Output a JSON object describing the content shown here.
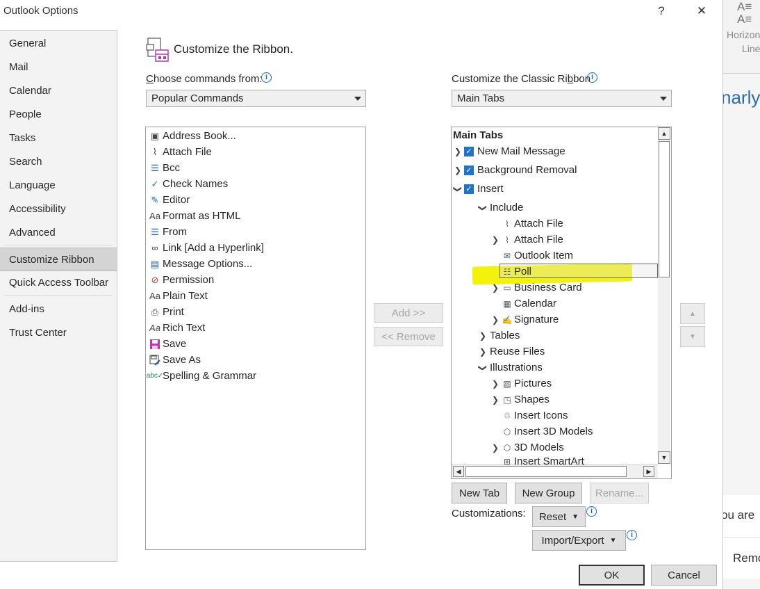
{
  "window": {
    "title": "Outlook Options",
    "help": "?",
    "close": "✕"
  },
  "nav": {
    "items": [
      {
        "label": "General"
      },
      {
        "label": "Mail"
      },
      {
        "label": "Calendar"
      },
      {
        "label": "People"
      },
      {
        "label": "Tasks"
      },
      {
        "label": "Search"
      },
      {
        "label": "Language"
      },
      {
        "label": "Accessibility"
      },
      {
        "label": "Advanced"
      },
      {
        "label": "Customize Ribbon"
      },
      {
        "label": "Quick Access Toolbar"
      },
      {
        "label": "Add-ins"
      },
      {
        "label": "Trust Center"
      }
    ],
    "active": "Customize Ribbon"
  },
  "header": {
    "title": "Customize the Ribbon."
  },
  "left": {
    "label": "Choose commands from:",
    "select_value": "Popular Commands",
    "commands": [
      {
        "label": "Address Book...",
        "icon": "address-book-icon"
      },
      {
        "label": "Attach File",
        "icon": "paperclip-icon"
      },
      {
        "label": "Bcc",
        "icon": "bcc-icon"
      },
      {
        "label": "Check Names",
        "icon": "check-names-icon"
      },
      {
        "label": "Editor",
        "icon": "editor-pen-icon"
      },
      {
        "label": "Format as HTML",
        "icon": "format-html-icon"
      },
      {
        "label": "From",
        "icon": "from-icon"
      },
      {
        "label": "Link [Add a Hyperlink]",
        "icon": "link-icon"
      },
      {
        "label": "Message Options...",
        "icon": "message-options-icon"
      },
      {
        "label": "Permission",
        "icon": "permission-icon"
      },
      {
        "label": "Plain Text",
        "icon": "plain-text-icon"
      },
      {
        "label": "Print",
        "icon": "printer-icon"
      },
      {
        "label": "Rich Text",
        "icon": "rich-text-icon"
      },
      {
        "label": "Save",
        "icon": "save-icon"
      },
      {
        "label": "Save As",
        "icon": "save-as-icon"
      },
      {
        "label": "Spelling & Grammar",
        "icon": "spelling-icon"
      }
    ]
  },
  "middle": {
    "add": "Add >>",
    "remove": "<< Remove"
  },
  "right": {
    "label": "Customize the Classic Ribbon",
    "select_value": "Main Tabs",
    "tree_header": "Main Tabs",
    "tree": {
      "new_mail": "New Mail Message",
      "bg_removal": "Background Removal",
      "insert": "Insert",
      "include": "Include",
      "attach_file_1": "Attach File",
      "attach_file_2": "Attach File",
      "outlook_item": "Outlook Item",
      "poll": "Poll",
      "business_card": "Business Card",
      "calendar": "Calendar",
      "signature": "Signature",
      "tables": "Tables",
      "reuse_files": "Reuse Files",
      "illustrations": "Illustrations",
      "pictures": "Pictures",
      "shapes": "Shapes",
      "insert_icons": "Insert Icons",
      "insert_3d": "Insert 3D Models",
      "models_3d": "3D Models",
      "smartart": "Insert SmartArt"
    },
    "new_tab": "New Tab",
    "new_group": "New Group",
    "rename": "Rename...",
    "customizations_label": "Customizations:",
    "reset": "Reset",
    "import_export": "Import/Export"
  },
  "footer": {
    "ok": "OK",
    "cancel": "Cancel"
  },
  "background_app": {
    "ribbon_label_1": "Horizon",
    "ribbon_label_2": "Line",
    "doc_text_1": "narly",
    "doc_text_2": "ou are",
    "doc_text_3": "Remo"
  },
  "colors": {
    "highlight": "#f5f50a",
    "checkbox": "#1f73c9",
    "info": "#1a6fbf"
  }
}
